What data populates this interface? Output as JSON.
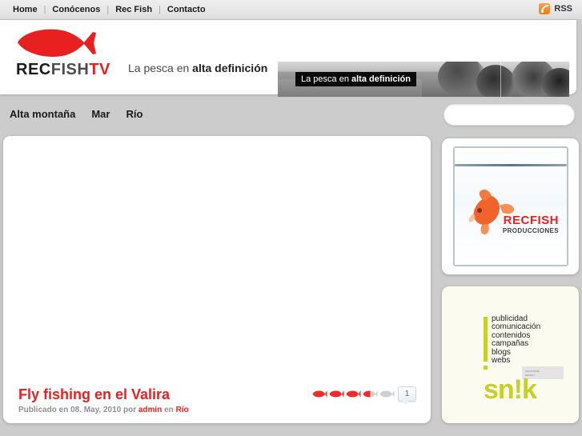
{
  "topbar": {
    "nav": [
      {
        "label": "Home"
      },
      {
        "label": "Conócenos"
      },
      {
        "label": "Rec Fish"
      },
      {
        "label": "Contacto"
      }
    ],
    "separator": "|",
    "rss_label": "RSS",
    "rss_icon": "rss-icon"
  },
  "header": {
    "logo": {
      "icon": "red-fish-logo",
      "text_part1": "REC",
      "text_part2": "FISH",
      "text_part3": "TV"
    },
    "tagline_plain": "La pesca en ",
    "tagline_bold": "alta definición",
    "banner": {
      "caption_plain": "La pesca en ",
      "caption_bold": "alta definición"
    }
  },
  "catnav": {
    "items": [
      {
        "label": "Alta montaña"
      },
      {
        "label": "Mar"
      },
      {
        "label": "Río"
      }
    ]
  },
  "search": {
    "value": "",
    "placeholder": "",
    "icon": "search-icon"
  },
  "main": {
    "post": {
      "title": "Fly fishing en el Valira",
      "meta_prefix": "Publicado en 08. May, 2010 por ",
      "meta_author": "admin",
      "meta_middle": " en ",
      "meta_category": "Río",
      "rating_fish_total": 5,
      "rating_value": 3.5,
      "comment_count": "1"
    }
  },
  "sidebar": {
    "ads": [
      {
        "name": "recfish-producciones",
        "brand_line1": "RECFISH",
        "brand_line2": "PRODUCCIONES",
        "image": "goldfish-in-aquarium"
      },
      {
        "name": "snik",
        "services": [
          "publicidad",
          "comunicación",
          "contenidos",
          "campañas",
          "blogs",
          "webs"
        ],
        "logo": "sn!k",
        "tag_line1": "comunica-",
        "tag_line2": "acción"
      }
    ]
  },
  "colors": {
    "brand_red": "#e8201f",
    "accent_rss": "#f07e18",
    "snik_green": "#c8cf2a",
    "page_bg": "#cccccc"
  }
}
